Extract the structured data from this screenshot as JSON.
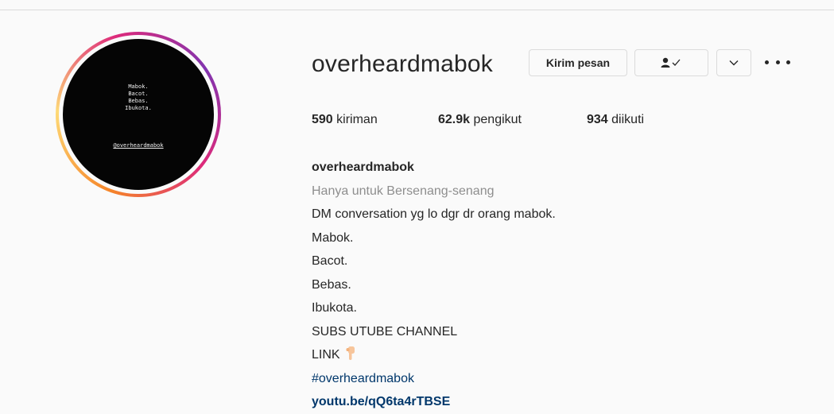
{
  "avatar": {
    "lines": [
      "Mabok.",
      "Bacot.",
      "Bebas.",
      "Ibukota."
    ],
    "handle": "@overheardmabok"
  },
  "profile": {
    "username": "overheardmabok",
    "message_button": "Kirim pesan",
    "follow_icon": "person-check-icon",
    "dropdown_icon": "chevron-down-icon",
    "more_icon": "more-options-icon"
  },
  "stats": {
    "posts_count": "590",
    "posts_label": "kiriman",
    "followers_count": "62.9k",
    "followers_label": "pengikut",
    "following_count": "934",
    "following_label": "diikuti"
  },
  "bio": {
    "name": "overheardmabok",
    "category": "Hanya untuk Bersenang-senang",
    "lines": [
      "DM conversation yg lo dgr dr orang mabok.",
      "Mabok.",
      "Bacot.",
      "Bebas.",
      "Ibukota.",
      "SUBS UTUBE CHANNEL"
    ],
    "link_label": "LINK",
    "hashtag": "#overheardmabok",
    "website": "youtu.be/qQ6ta4rTBSE"
  },
  "colors": {
    "link": "#00376b",
    "muted": "#8e8e8e",
    "border": "#dbdbdb"
  }
}
